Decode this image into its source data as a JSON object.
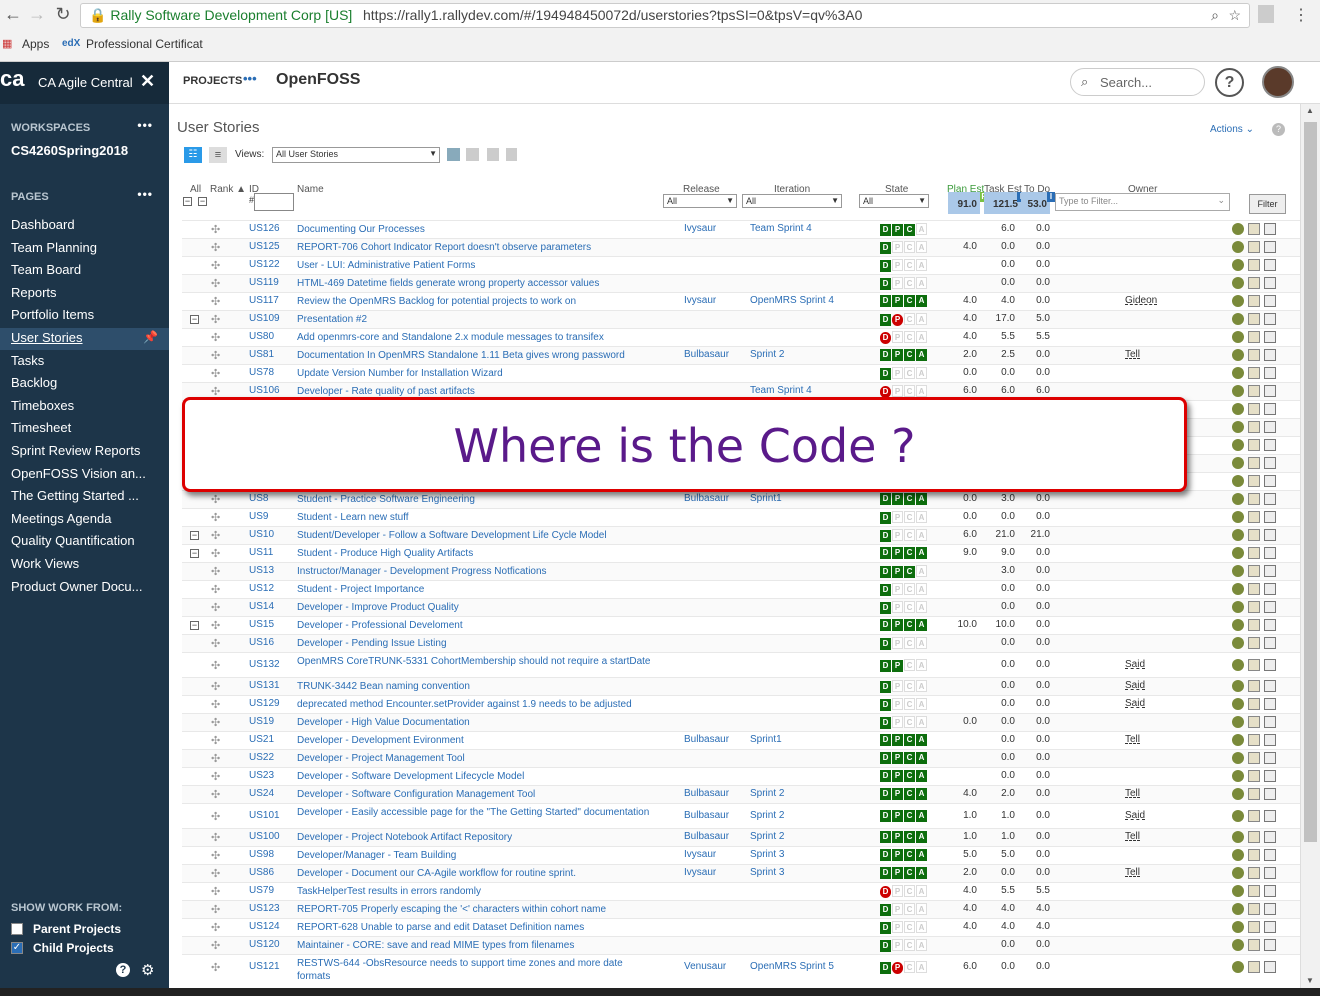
{
  "browser": {
    "secure_label": "Rally Software Development Corp [US]",
    "url": "https://rally1.rallydev.com/#/194948450072d/userstories?tpsSI=0&tpsV=qv%3A0",
    "bookmarks": [
      "Apps",
      "Professional Certificat"
    ]
  },
  "sidebar": {
    "app_name": "CA Agile Central",
    "workspaces_label": "WORKSPACES",
    "workspace_name": "CS4260Spring2018",
    "pages_label": "PAGES",
    "items": [
      "Dashboard",
      "Team Planning",
      "Team Board",
      "Reports",
      "Portfolio Items",
      "User Stories",
      "Tasks",
      "Backlog",
      "Timeboxes",
      "Timesheet",
      "Sprint Review Reports",
      "OpenFOSS Vision an...",
      "The Getting Started ...",
      "Meetings Agenda",
      "Quality Quantification",
      "Work Views",
      "Product Owner Docu..."
    ],
    "active": "User Stories",
    "show_work_label": "SHOW WORK FROM:",
    "parent_projects": "Parent Projects",
    "child_projects": "Child Projects"
  },
  "topbar": {
    "projects_label": "PROJECTS",
    "project_name": "OpenFOSS",
    "search_placeholder": "Search..."
  },
  "grid": {
    "title": "User Stories",
    "actions_label": "Actions",
    "views_label": "Views:",
    "views_value": "All User Stories",
    "headers": {
      "all": "All",
      "rank": "Rank",
      "id": "ID",
      "name": "Name",
      "release": "Release",
      "iteration": "Iteration",
      "state": "State",
      "plan_est": "Plan Est",
      "task_est": "Task Est",
      "to_do": "To Do",
      "owner": "Owner"
    },
    "filter_all": "All",
    "id_filter": "#",
    "owner_placeholder": "Type to Filter...",
    "filter_button": "Filter",
    "totals": {
      "plan_est": "91.0",
      "task_est": "121.5",
      "to_do": "53.0"
    }
  },
  "rows": [
    {
      "id": "US126",
      "name": "Documenting Our Processes",
      "release": "Ivysaur",
      "iteration": "Team Sprint 4",
      "state": "DPC_",
      "plan": "",
      "task": "6.0",
      "todo": "0.0",
      "owner": "",
      "pm": ""
    },
    {
      "id": "US125",
      "name": "REPORT-706 Cohort Indicator Report doesn't observe parameters",
      "release": "",
      "iteration": "",
      "state": "D___",
      "plan": "4.0",
      "task": "0.0",
      "todo": "0.0",
      "owner": "",
      "pm": ""
    },
    {
      "id": "US122",
      "name": "User - LUI: Administrative Patient Forms",
      "release": "",
      "iteration": "",
      "state": "D___",
      "plan": "",
      "task": "0.0",
      "todo": "0.0",
      "owner": "",
      "pm": ""
    },
    {
      "id": "US119",
      "name": "HTML-469 Datetime fields generate wrong property accessor values",
      "release": "",
      "iteration": "",
      "state": "D___",
      "plan": "",
      "task": "0.0",
      "todo": "0.0",
      "owner": "",
      "pm": ""
    },
    {
      "id": "US117",
      "name": "Review the OpenMRS Backlog for potential projects to work on",
      "release": "Ivysaur",
      "iteration": "OpenMRS Sprint 4",
      "state": "DPCA",
      "plan": "4.0",
      "task": "4.0",
      "todo": "0.0",
      "owner": "Gideon",
      "pm": ""
    },
    {
      "id": "US109",
      "name": "Presentation #2",
      "release": "",
      "iteration": "",
      "state": "DX__",
      "plan": "4.0",
      "task": "17.0",
      "todo": "5.0",
      "owner": "",
      "pm": "−"
    },
    {
      "id": "US80",
      "name": "Add openmrs-core and Standalone 2.x module messages to transifex",
      "release": "",
      "iteration": "",
      "state": "X___",
      "plan": "4.0",
      "task": "5.5",
      "todo": "5.5",
      "owner": "",
      "pm": ""
    },
    {
      "id": "US81",
      "name": "Documentation In OpenMRS Standalone 1.11 Beta gives wrong password",
      "release": "Bulbasaur",
      "iteration": "Sprint 2",
      "state": "DPCA",
      "plan": "2.0",
      "task": "2.5",
      "todo": "0.0",
      "owner": "Tell",
      "pm": ""
    },
    {
      "id": "US78",
      "name": "Update Version Number for Installation Wizard",
      "release": "",
      "iteration": "",
      "state": "D___",
      "plan": "0.0",
      "task": "0.0",
      "todo": "0.0",
      "owner": "",
      "pm": ""
    },
    {
      "id": "US106",
      "name": "Developer - Rate quality of past artifacts",
      "release": "",
      "iteration": "Team Sprint 4",
      "state": "X___",
      "plan": "6.0",
      "task": "6.0",
      "todo": "6.0",
      "owner": "",
      "pm": ""
    },
    {
      "id": "",
      "name": "",
      "release": "",
      "iteration": "",
      "state": "DPCA",
      "plan": "",
      "task": "",
      "todo": "",
      "owner": "",
      "pm": ""
    },
    {
      "id": "",
      "name": "",
      "release": "",
      "iteration": "",
      "state": "DPCA",
      "plan": "",
      "task": "",
      "todo": "",
      "owner": "",
      "pm": ""
    },
    {
      "id": "",
      "name": "",
      "release": "",
      "iteration": "",
      "state": "DPCA",
      "plan": "",
      "task": "",
      "todo": "",
      "owner": "",
      "pm": ""
    },
    {
      "id": "",
      "name": "",
      "release": "",
      "iteration": "",
      "state": "DPCA",
      "plan": "",
      "task": "",
      "todo": "",
      "owner": "",
      "pm": ""
    },
    {
      "id": "",
      "name": "",
      "release": "",
      "iteration": "",
      "state": "DPCA",
      "plan": "",
      "task": "",
      "todo": "",
      "owner": "",
      "pm": ""
    },
    {
      "id": "US8",
      "name": "Student - Practice Software Engineering",
      "release": "Bulbasaur",
      "iteration": "Sprint1",
      "state": "DPCA",
      "plan": "0.0",
      "task": "3.0",
      "todo": "0.0",
      "owner": "",
      "pm": ""
    },
    {
      "id": "US9",
      "name": "Student - Learn new stuff",
      "release": "",
      "iteration": "",
      "state": "D___",
      "plan": "0.0",
      "task": "0.0",
      "todo": "0.0",
      "owner": "",
      "pm": ""
    },
    {
      "id": "US10",
      "name": "Student/Developer - Follow a Software Development Life Cycle Model",
      "release": "",
      "iteration": "",
      "state": "D___",
      "plan": "6.0",
      "task": "21.0",
      "todo": "21.0",
      "owner": "",
      "pm": "−"
    },
    {
      "id": "US11",
      "name": "Student - Produce High Quality Artifacts",
      "release": "",
      "iteration": "",
      "state": "DPCA",
      "plan": "9.0",
      "task": "9.0",
      "todo": "0.0",
      "owner": "",
      "pm": "−"
    },
    {
      "id": "US13",
      "name": "Instructor/Manager - Development Progress Notfications",
      "release": "",
      "iteration": "",
      "state": "DPC_",
      "plan": "",
      "task": "3.0",
      "todo": "0.0",
      "owner": "",
      "pm": ""
    },
    {
      "id": "US12",
      "name": "Student - Project Importance",
      "release": "",
      "iteration": "",
      "state": "D___",
      "plan": "",
      "task": "0.0",
      "todo": "0.0",
      "owner": "",
      "pm": ""
    },
    {
      "id": "US14",
      "name": "Developer - Improve Product Quality",
      "release": "",
      "iteration": "",
      "state": "D___",
      "plan": "",
      "task": "0.0",
      "todo": "0.0",
      "owner": "",
      "pm": ""
    },
    {
      "id": "US15",
      "name": "Developer - Professional Develoment",
      "release": "",
      "iteration": "",
      "state": "DPCA",
      "plan": "10.0",
      "task": "10.0",
      "todo": "0.0",
      "owner": "",
      "pm": "−"
    },
    {
      "id": "US16",
      "name": "Developer - Pending Issue Listing",
      "release": "",
      "iteration": "",
      "state": "D___",
      "plan": "",
      "task": "0.0",
      "todo": "0.0",
      "owner": "",
      "pm": ""
    },
    {
      "id": "US132",
      "name": "OpenMRS CoreTRUNK-5331 CohortMembership should not require a startDate",
      "release": "",
      "iteration": "",
      "state": "DP__",
      "plan": "",
      "task": "0.0",
      "todo": "0.0",
      "owner": "Said",
      "pm": "",
      "tall": true
    },
    {
      "id": "US131",
      "name": "TRUNK-3442 Bean naming convention",
      "release": "",
      "iteration": "",
      "state": "D___",
      "plan": "",
      "task": "0.0",
      "todo": "0.0",
      "owner": "Said",
      "pm": ""
    },
    {
      "id": "US129",
      "name": "deprecated method Encounter.setProvider against 1.9 needs to be adjusted",
      "release": "",
      "iteration": "",
      "state": "D___",
      "plan": "",
      "task": "0.0",
      "todo": "0.0",
      "owner": "Said",
      "pm": ""
    },
    {
      "id": "US19",
      "name": "Developer - High Value Documentation",
      "release": "",
      "iteration": "",
      "state": "D___",
      "plan": "0.0",
      "task": "0.0",
      "todo": "0.0",
      "owner": "",
      "pm": ""
    },
    {
      "id": "US21",
      "name": "Developer - Development Evironment",
      "release": "Bulbasaur",
      "iteration": "Sprint1",
      "state": "DPCA",
      "plan": "",
      "task": "0.0",
      "todo": "0.0",
      "owner": "Tell",
      "pm": ""
    },
    {
      "id": "US22",
      "name": "Developer - Project Management Tool",
      "release": "",
      "iteration": "",
      "state": "DPCA",
      "plan": "",
      "task": "0.0",
      "todo": "0.0",
      "owner": "",
      "pm": ""
    },
    {
      "id": "US23",
      "name": "Developer - Software Development Lifecycle Model",
      "release": "",
      "iteration": "",
      "state": "DPCA",
      "plan": "",
      "task": "0.0",
      "todo": "0.0",
      "owner": "",
      "pm": ""
    },
    {
      "id": "US24",
      "name": "Developer - Software Configuration Management Tool",
      "release": "Bulbasaur",
      "iteration": "Sprint 2",
      "state": "DPCA",
      "plan": "4.0",
      "task": "2.0",
      "todo": "0.0",
      "owner": "Tell",
      "pm": ""
    },
    {
      "id": "US101",
      "name": "Developer - Easily accessible page for the \"The Getting Started\" documentation",
      "release": "Bulbasaur",
      "iteration": "Sprint 2",
      "state": "DPCA",
      "plan": "1.0",
      "task": "1.0",
      "todo": "0.0",
      "owner": "Said",
      "pm": "",
      "tall": true
    },
    {
      "id": "US100",
      "name": "Developer - Project Notebook Artifact Repository",
      "release": "Bulbasaur",
      "iteration": "Sprint 2",
      "state": "DPCA",
      "plan": "1.0",
      "task": "1.0",
      "todo": "0.0",
      "owner": "Tell",
      "pm": ""
    },
    {
      "id": "US98",
      "name": "Developer/Manager - Team Building",
      "release": "Ivysaur",
      "iteration": "Sprint 3",
      "state": "DPCA",
      "plan": "5.0",
      "task": "5.0",
      "todo": "0.0",
      "owner": "",
      "pm": ""
    },
    {
      "id": "US86",
      "name": "Developer - Document our CA-Agile workflow for routine sprint.",
      "release": "Ivysaur",
      "iteration": "Sprint 3",
      "state": "DPCA",
      "plan": "2.0",
      "task": "0.0",
      "todo": "0.0",
      "owner": "Tell",
      "pm": ""
    },
    {
      "id": "US79",
      "name": "TaskHelperTest results in errors randomly",
      "release": "",
      "iteration": "",
      "state": "X___",
      "plan": "4.0",
      "task": "5.5",
      "todo": "5.5",
      "owner": "",
      "pm": ""
    },
    {
      "id": "US123",
      "name": "REPORT-705 Properly escaping the '<' characters within cohort name",
      "release": "",
      "iteration": "",
      "state": "D___",
      "plan": "4.0",
      "task": "4.0",
      "todo": "4.0",
      "owner": "",
      "pm": ""
    },
    {
      "id": "US124",
      "name": "REPORT-628 Unable to parse and edit Dataset Definition names",
      "release": "",
      "iteration": "",
      "state": "D___",
      "plan": "4.0",
      "task": "4.0",
      "todo": "4.0",
      "owner": "",
      "pm": ""
    },
    {
      "id": "US120",
      "name": "Maintainer - CORE: save and read MIME types from filenames",
      "release": "",
      "iteration": "",
      "state": "D___",
      "plan": "",
      "task": "0.0",
      "todo": "0.0",
      "owner": "",
      "pm": ""
    },
    {
      "id": "US121",
      "name": "RESTWS-644 -ObsResource needs to support time zones and more date formats",
      "release": "Venusaur",
      "iteration": "OpenMRS Sprint 5",
      "state": "DX__",
      "plan": "6.0",
      "task": "0.0",
      "todo": "0.0",
      "owner": "",
      "pm": "",
      "tall": true
    }
  ],
  "callout": {
    "text": "Where is the Code ?"
  },
  "colors": {
    "sidebar": "#1d3549",
    "accent": "#2a6db5",
    "state_done": "#0d6e0d",
    "blocked": "#cc0000",
    "callout_border": "#dd0000",
    "callout_text": "#5a1a8a"
  }
}
